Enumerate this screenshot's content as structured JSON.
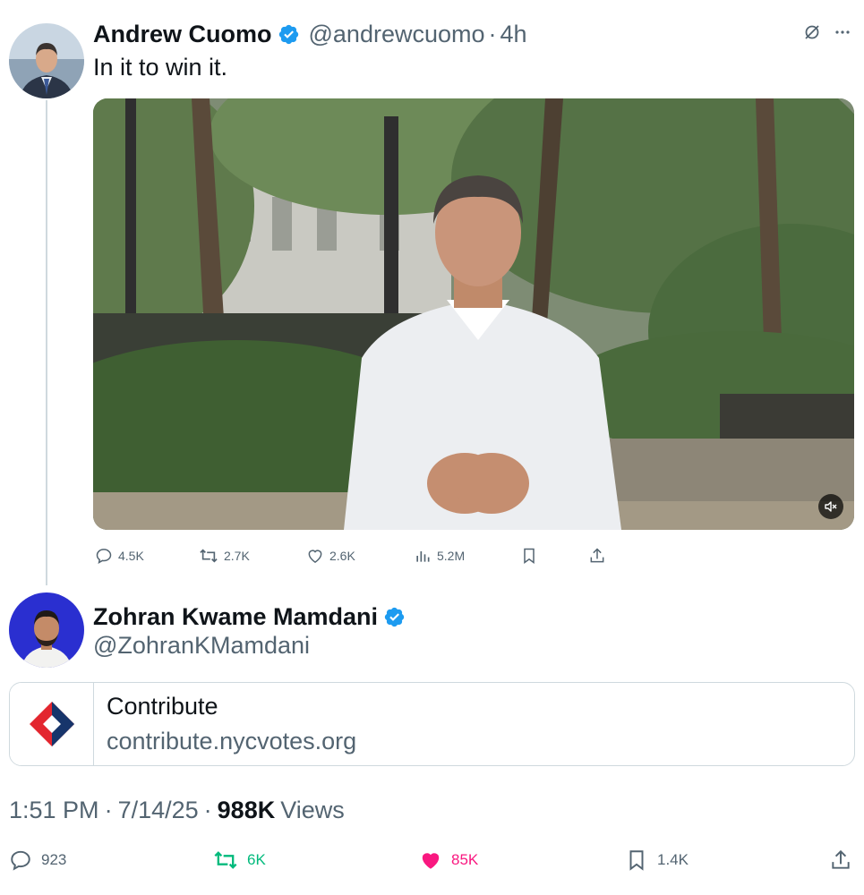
{
  "quoted_tweet": {
    "display_name": "Andrew Cuomo",
    "handle": "@andrewcuomo",
    "separator": "·",
    "time": "4h",
    "text": "In it to win it.",
    "actions": {
      "replies": "4.5K",
      "reposts": "2.7K",
      "likes": "2.6K",
      "views": "5.2M"
    }
  },
  "main_tweet": {
    "display_name": "Zohran Kwame Mamdani",
    "handle": "@ZohranKMamdani",
    "card": {
      "title": "Contribute",
      "domain": "contribute.nycvotes.org"
    },
    "meta": {
      "time": "1:51 PM",
      "separator": "·",
      "date": "7/14/25",
      "views_count": "988K",
      "views_label": "Views"
    },
    "actions": {
      "replies": "923",
      "reposts": "6K",
      "likes": "85K",
      "bookmarks": "1.4K"
    }
  },
  "colors": {
    "verified_blue": "#1d9bf0",
    "repost_green": "#00ba7c",
    "like_pink": "#f91880",
    "secondary_text": "#536471"
  }
}
